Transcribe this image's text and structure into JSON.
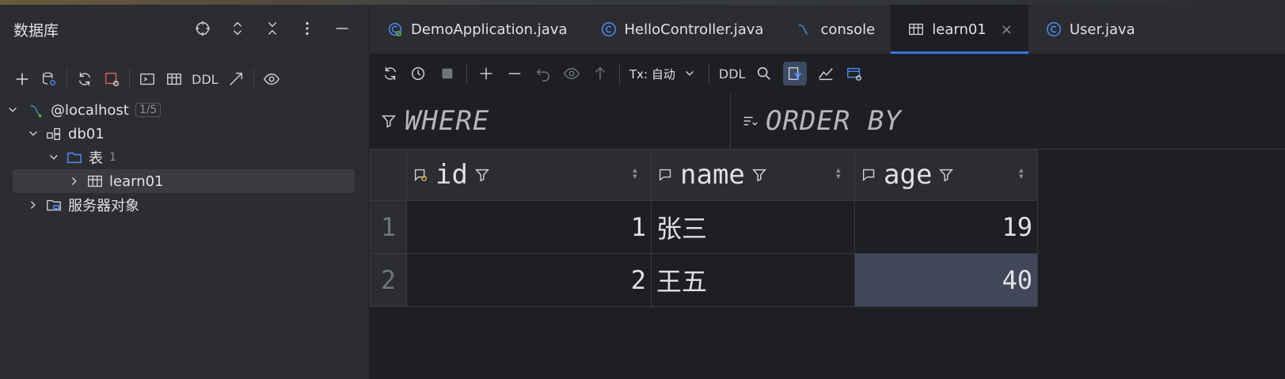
{
  "left_panel": {
    "title": "数据库",
    "toolbar": {
      "ddl_label": "DDL"
    },
    "tree": [
      {
        "label": "@localhost",
        "badge": "1/5"
      },
      {
        "label": "db01"
      },
      {
        "label": "表",
        "count": "1"
      },
      {
        "label": "learn01"
      },
      {
        "label": "服务器对象"
      }
    ]
  },
  "tabs": [
    {
      "label": "DemoApplication.java"
    },
    {
      "label": "HelloController.java"
    },
    {
      "label": "console"
    },
    {
      "label": "learn01",
      "close": "×"
    },
    {
      "label": "User.java"
    }
  ],
  "editor_toolbar": {
    "tx_label": "Tx: 自动",
    "ddl_label": "DDL"
  },
  "filter": {
    "where_label": "WHERE",
    "order_label": "ORDER BY"
  },
  "table": {
    "columns": [
      "id",
      "name",
      "age"
    ],
    "rows": [
      {
        "num": "1",
        "id": "1",
        "name": "张三",
        "age": "19"
      },
      {
        "num": "2",
        "id": "2",
        "name": "王五",
        "age": "40"
      }
    ]
  },
  "colors": {
    "accent": "#3574f0",
    "background": "#1e1f22",
    "panel": "#2b2d30"
  }
}
